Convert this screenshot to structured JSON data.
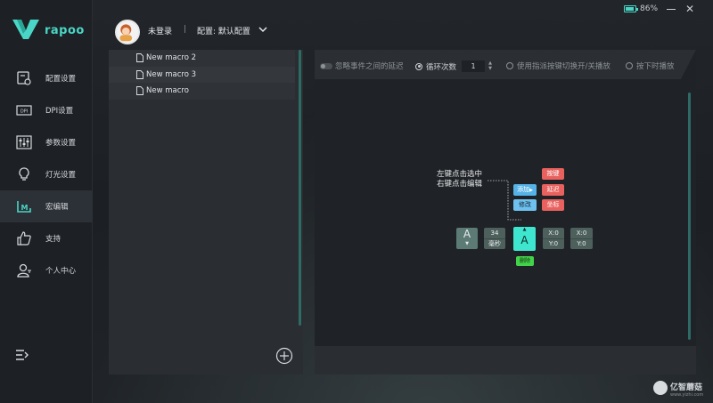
{
  "app": {
    "brand": "rapoo",
    "accent": "#4ad6c6"
  },
  "sidebar": {
    "items": [
      {
        "label": "配置设置",
        "icon": "config-icon"
      },
      {
        "label": "DPI设置",
        "icon": "dpi-icon"
      },
      {
        "label": "参数设置",
        "icon": "sliders-icon"
      },
      {
        "label": "灯光设置",
        "icon": "bulb-icon"
      },
      {
        "label": "宏编辑",
        "icon": "macro-icon",
        "active": true
      },
      {
        "label": "支持",
        "icon": "thumbs-up-icon"
      },
      {
        "label": "个人中心",
        "icon": "user-icon"
      }
    ]
  },
  "topbar": {
    "login": "未登录",
    "separator": "|",
    "config": "配置: 默认配置",
    "battery_pct": "86%",
    "battery_level": 0.86,
    "close": "✕"
  },
  "macros": {
    "items": [
      "New macro 2",
      "New macro 3",
      "New macro"
    ]
  },
  "toolbar": {
    "ignore_delay": "忽略事件之间的延迟",
    "loop_count_label": "循环次数",
    "loop_count_value": "1",
    "toggle_play": "使用指派按键切换开/关播放",
    "hold_play": "按下时播放"
  },
  "hint": {
    "line1": "左键点击选中",
    "line2": "右键点击编辑"
  },
  "blocks": {
    "key1": "A",
    "delay_value": "34",
    "delay_unit": "毫秒",
    "key2": "A",
    "coord1_x": "X:0",
    "coord1_y": "Y:0",
    "coord2_x": "X:0",
    "coord2_y": "Y:0"
  },
  "actions": {
    "add": "添加",
    "modify": "修改",
    "key": "按键",
    "delay": "延迟",
    "coord": "坐标",
    "delete": "删除"
  },
  "watermark": {
    "name": "亿智蘑菇",
    "url": "www.yizhi.com"
  }
}
